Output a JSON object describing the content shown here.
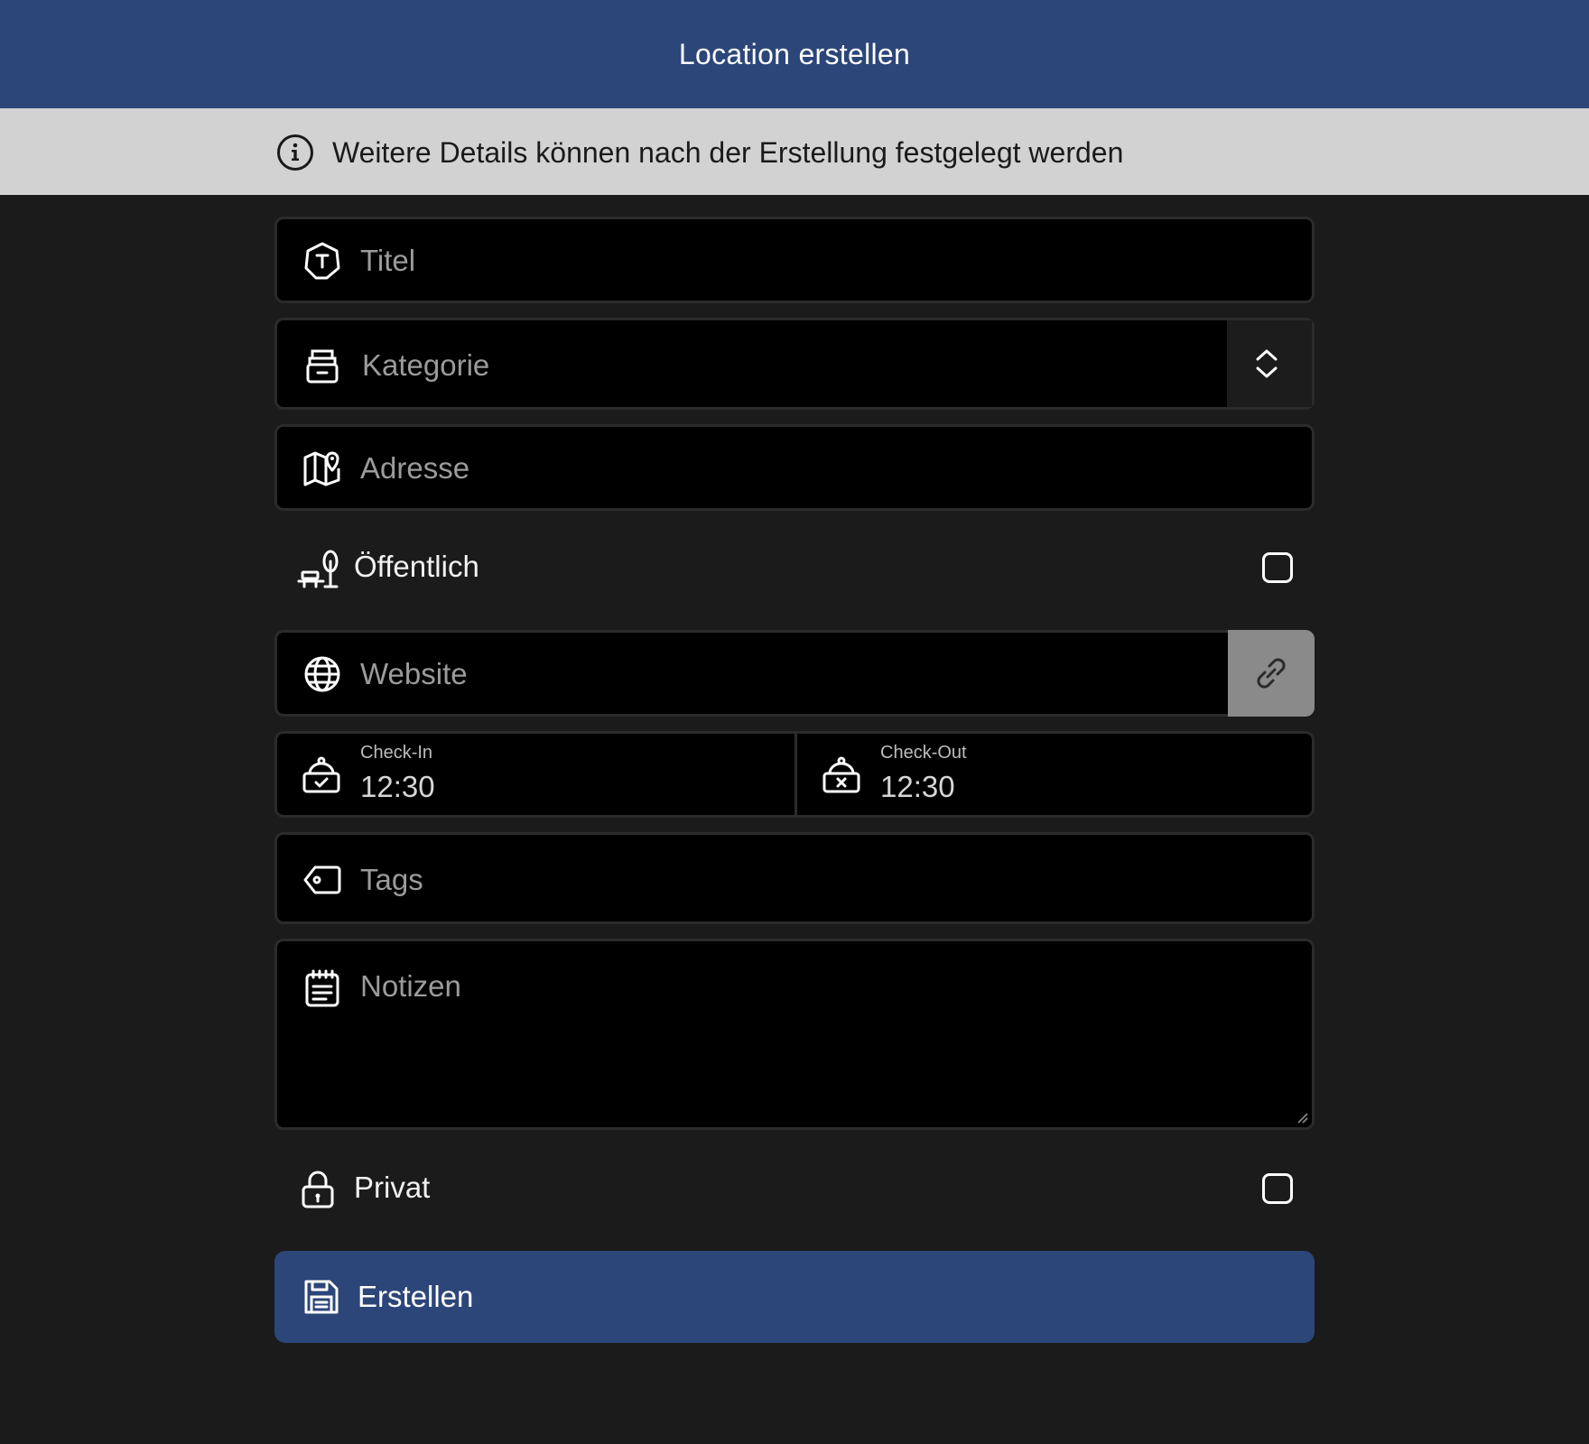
{
  "header": {
    "title": "Location erstellen"
  },
  "info": {
    "text": "Weitere Details können nach der Erstellung festgelegt werden",
    "icon": "info-icon"
  },
  "form": {
    "title": {
      "placeholder": "Titel",
      "icon": "title-icon"
    },
    "category": {
      "placeholder": "Kategorie",
      "icon": "category-icon"
    },
    "address": {
      "placeholder": "Adresse",
      "icon": "map-pin-icon"
    },
    "public": {
      "label": "Öffentlich",
      "checked": false,
      "icon": "park-bench-icon"
    },
    "website": {
      "placeholder": "Website",
      "icon": "globe-icon",
      "action_icon": "link-icon"
    },
    "check_in": {
      "label": "Check-In",
      "value": "12:30",
      "icon": "check-in-bell-icon"
    },
    "check_out": {
      "label": "Check-Out",
      "value": "12:30",
      "icon": "check-out-bell-icon"
    },
    "tags": {
      "placeholder": "Tags",
      "icon": "tag-icon"
    },
    "notes": {
      "placeholder": "Notizen",
      "icon": "notes-icon"
    },
    "private": {
      "label": "Privat",
      "checked": false,
      "icon": "lock-icon"
    }
  },
  "actions": {
    "create_label": "Erstellen",
    "create_icon": "save-icon"
  },
  "colors": {
    "accent": "#2c4679",
    "background": "#1b1b1b",
    "field": "#000000",
    "info_bar": "#d2d2d2"
  }
}
